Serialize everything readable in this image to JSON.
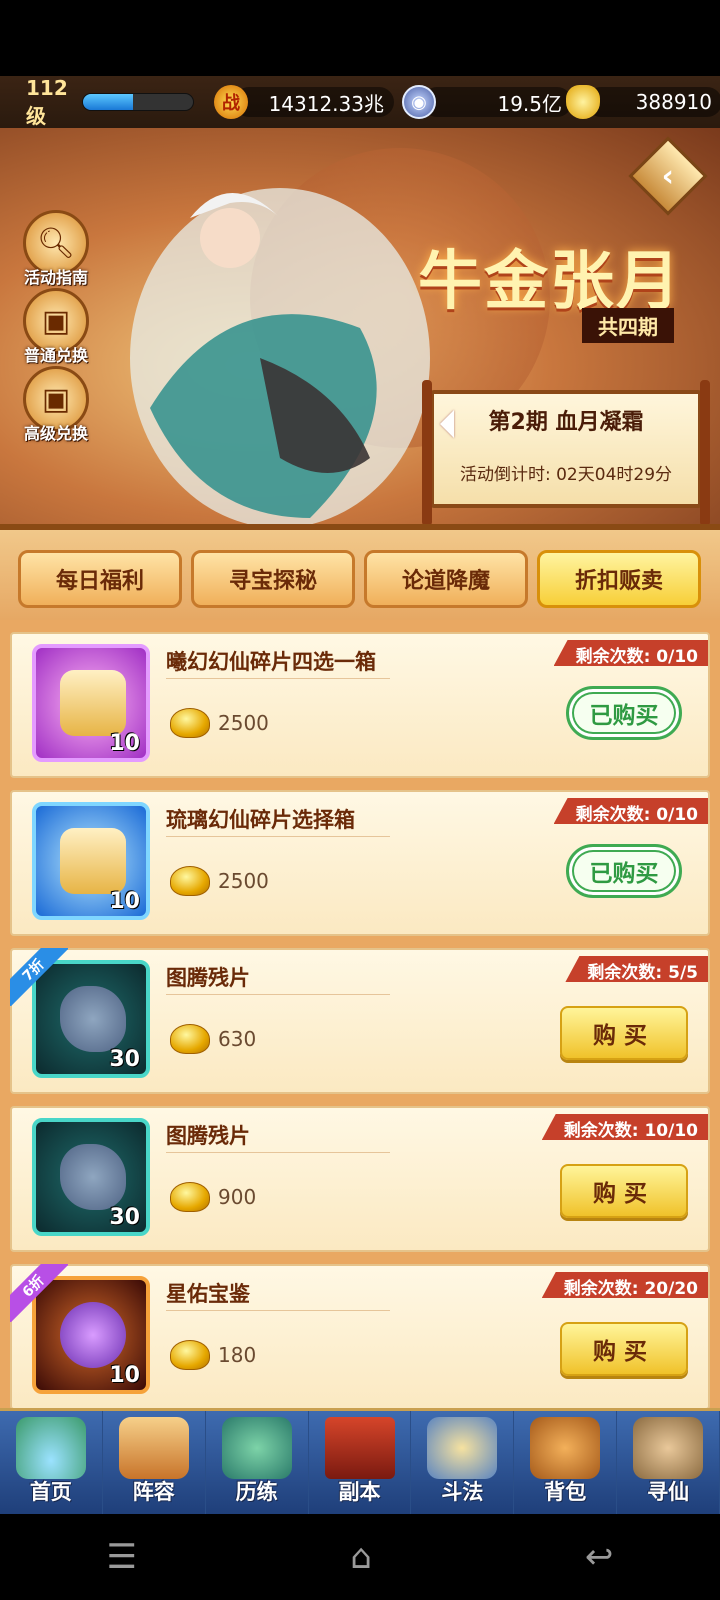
{
  "status": {
    "level": "112级",
    "level_progress": 0.45,
    "power_icon": "战",
    "power": "14312.33兆",
    "silver": "19.5亿",
    "gold": "388910"
  },
  "banner": {
    "title": "牛金张月",
    "subtitle": "共四期",
    "side_buttons": [
      {
        "label": "活动指南",
        "icon": "magnifier-icon"
      },
      {
        "label": "普通兑换",
        "icon": "gift-box-icon"
      },
      {
        "label": "高级兑换",
        "icon": "gift-box-icon"
      }
    ],
    "period": "第2期 血月凝霜",
    "countdown": "活动倒计时: 02天04时29分"
  },
  "tabs": [
    {
      "label": "每日福利",
      "active": false
    },
    {
      "label": "寻宝探秘",
      "active": false
    },
    {
      "label": "论道降魔",
      "active": false
    },
    {
      "label": "折扣贩卖",
      "active": true
    }
  ],
  "items": [
    {
      "name": "曦幻幻仙碎片四选一箱",
      "qty": "10",
      "price": "2500",
      "remaining": "剩余次数: 0/10",
      "button": "已购买",
      "discount": ""
    },
    {
      "name": "琉璃幻仙碎片选择箱",
      "qty": "10",
      "price": "2500",
      "remaining": "剩余次数: 0/10",
      "button": "已购买",
      "discount": ""
    },
    {
      "name": "图腾残片",
      "qty": "30",
      "price": "630",
      "remaining": "剩余次数: 5/5",
      "button": "购买",
      "discount": "7折"
    },
    {
      "name": "图腾残片",
      "qty": "30",
      "price": "900",
      "remaining": "剩余次数: 10/10",
      "button": "购买",
      "discount": ""
    },
    {
      "name": "星佑宝鉴",
      "qty": "10",
      "price": "180",
      "remaining": "剩余次数: 20/20",
      "button": "购买",
      "discount": "6折"
    }
  ],
  "nav": [
    "首页",
    "阵容",
    "历练",
    "副本",
    "斗法",
    "背包",
    "寻仙"
  ],
  "colors": {
    "accent_gold": "#f7cf38",
    "remain_badge": "#c6402a",
    "bought_green": "#3faa52",
    "nav_blue": "#3e6bb0"
  }
}
